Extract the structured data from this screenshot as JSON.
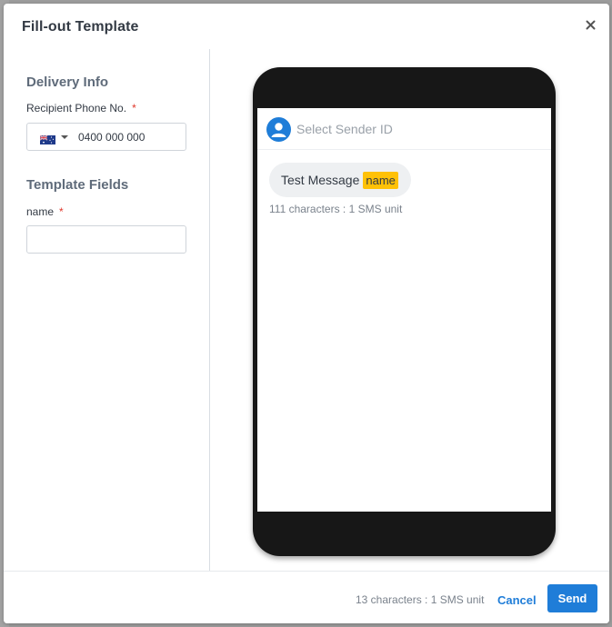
{
  "modal": {
    "title": "Fill-out Template"
  },
  "delivery": {
    "heading": "Delivery Info",
    "phone_label": "Recipient Phone No.",
    "required_mark": "*",
    "country_flag": "AU-flag-icon",
    "phone_placeholder": "0400 000 000"
  },
  "template": {
    "heading": "Template Fields",
    "name_label": "name",
    "required_mark": "*",
    "name_value": ""
  },
  "preview": {
    "sender_placeholder": "Select Sender ID",
    "message_text": "Test Message",
    "message_tag": "name",
    "char_count": "111 characters : 1 SMS unit"
  },
  "footer": {
    "char_count": "13 characters : 1 SMS unit",
    "cancel_label": "Cancel",
    "send_label": "Send"
  },
  "colors": {
    "accent": "#1f7dd8",
    "tag_highlight": "#ffc107",
    "required": "#e0372b"
  }
}
